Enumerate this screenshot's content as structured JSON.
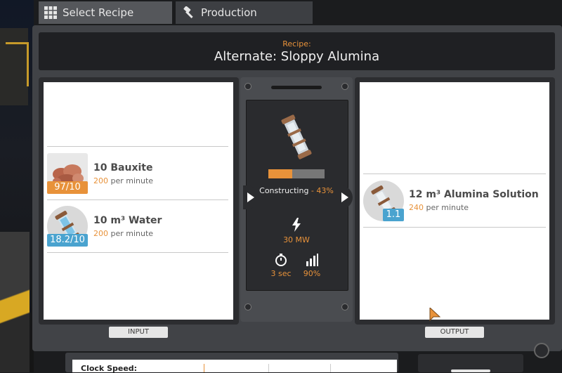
{
  "tabs": [
    {
      "label": "Select Recipe",
      "icon": "grid-icon",
      "active": true
    },
    {
      "label": "Production",
      "icon": "hammer-icon",
      "active": false
    }
  ],
  "recipe": {
    "label": "Recipe:",
    "name": "Alternate: Sloppy Alumina"
  },
  "inputs": [
    {
      "amount_name": "10 Bauxite",
      "rate": "200",
      "rate_unit": "per minute",
      "badge": "97/10",
      "badge_color": "#e8923a",
      "icon": "bauxite-icon"
    },
    {
      "amount_name": "10 m³ Water",
      "rate": "200",
      "rate_unit": "per minute",
      "badge": "18.2/10",
      "badge_color": "#4aa3cf",
      "icon": "water-canister-icon"
    }
  ],
  "outputs": [
    {
      "amount_name": "12 m³ Alumina Solution",
      "rate": "240",
      "rate_unit": "per minute",
      "badge": "1.1",
      "badge_color": "#4aa3cf",
      "icon": "alumina-canister-icon"
    }
  ],
  "machine": {
    "status": "Constructing",
    "progress_text": " - 43%",
    "progress": 0.43,
    "power": "30 MW",
    "cycle_time": "3 sec",
    "efficiency": "90%"
  },
  "labels": {
    "input": "INPUT",
    "output": "OUTPUT",
    "clock_speed": "Clock Speed:"
  },
  "colors": {
    "accent": "#e8923a",
    "blue_badge": "#4aa3cf"
  }
}
